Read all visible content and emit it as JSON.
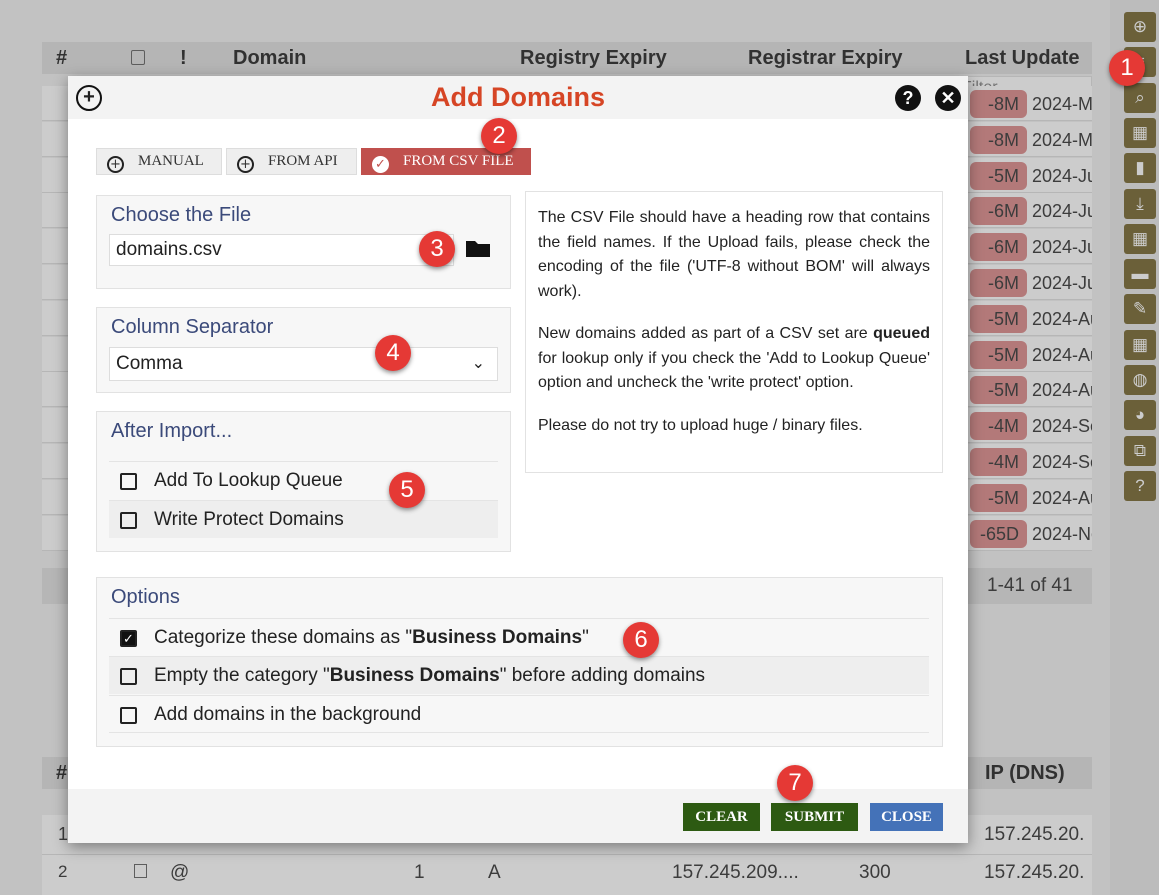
{
  "background": {
    "columns": [
      "#",
      "!",
      "Domain",
      "Registry Expiry",
      "Registrar Expiry",
      "Last Update"
    ],
    "filter_placeholder": "Filter",
    "rows": [
      {
        "age": "-8M",
        "update": "2024-M"
      },
      {
        "age": "-8M",
        "update": "2024-M"
      },
      {
        "age": "-5M",
        "update": "2024-Ju"
      },
      {
        "age": "-6M",
        "update": "2024-Ju"
      },
      {
        "age": "-6M",
        "update": "2024-Ju"
      },
      {
        "age": "-6M",
        "update": "2024-Ju"
      },
      {
        "age": "-5M",
        "update": "2024-Au"
      },
      {
        "age": "-5M",
        "update": "2024-Au"
      },
      {
        "age": "-5M",
        "update": "2024-Au"
      },
      {
        "age": "-4M",
        "update": "2024-Se"
      },
      {
        "age": "-4M",
        "update": "2024-Se"
      },
      {
        "age": "-5M",
        "update": "2024-Au"
      },
      {
        "age": "-65D",
        "update": "2024-No"
      }
    ],
    "pager": "1-41 of 41",
    "sub_columns": [
      "#",
      "IP (DNS)"
    ],
    "sub_rows": [
      {
        "n": "1",
        "ip": "157.245.20."
      },
      {
        "n": "2",
        "sub": "@",
        "a": "1",
        "type": "A",
        "value": "157.245.209....",
        "ttl": "300",
        "ip": "157.245.20."
      }
    ]
  },
  "toolbar_icons": [
    "add-icon",
    "list-icon",
    "search-icon",
    "grid-search-icon",
    "bookmark-icon",
    "download-icon",
    "grid-add-icon",
    "folder-check-icon",
    "pencil-icon",
    "grid-settings-icon",
    "globe-icon",
    "palette-icon",
    "external-link-icon",
    "help-icon"
  ],
  "modal": {
    "title": "Add Domains",
    "tabs": [
      {
        "label": "MANUAL",
        "icon": "add-icon"
      },
      {
        "label": "FROM API",
        "icon": "add-icon"
      },
      {
        "label": "FROM CSV FILE",
        "icon": "check-icon",
        "active": true
      }
    ],
    "file": {
      "title": "Choose the File",
      "value": "domains.csv"
    },
    "separator": {
      "title": "Column Separator",
      "value": "Comma"
    },
    "after_import": {
      "title": "After Import...",
      "options": [
        {
          "label": "Add To Lookup Queue",
          "checked": false
        },
        {
          "label": "Write Protect Domains",
          "checked": false
        }
      ]
    },
    "info": {
      "p1": "The CSV File should have a heading row that contains the field names. If the Upload fails, please check the encoding of the file ('UTF-8 without BOM' will always work).",
      "p2_a": "New domains added as part of a CSV set are ",
      "p2_b": "queued",
      "p2_c": " for lookup only if you check the 'Add to Lookup Queue' option and uncheck the 'write protect' option.",
      "p3": "Please do not try to upload huge / binary files."
    },
    "options": {
      "title": "Options",
      "category": "Business Domains",
      "opt1_a": "Categorize these domains as \"",
      "opt1_c": "\"",
      "opt2_a": "Empty the category \"",
      "opt2_c": "\" before adding domains",
      "opt3": "Add domains in the background",
      "checked": [
        true,
        false,
        false
      ]
    },
    "buttons": {
      "clear": "CLEAR",
      "submit": "SUBMIT",
      "close": "CLOSE"
    }
  },
  "callouts": [
    "1",
    "2",
    "3",
    "4",
    "5",
    "6",
    "7"
  ],
  "colors": {
    "accent": "#d64525",
    "tab_active": "#c0504d",
    "btn_green": "#2d5a12",
    "btn_blue": "#4472b8",
    "toolbar": "#6b5a1e",
    "callout": "#e53935"
  }
}
